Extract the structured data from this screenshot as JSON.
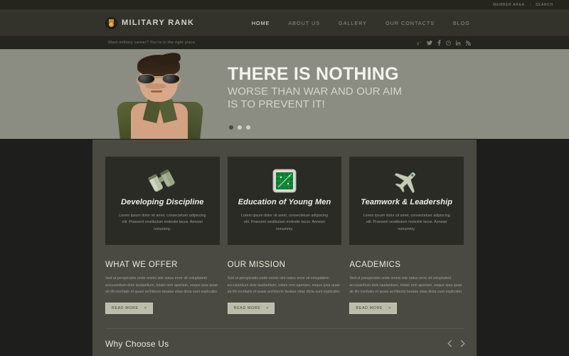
{
  "topbar": {
    "member_area": "MEMBER AREA",
    "separator": "|",
    "search": "SEARCH"
  },
  "header": {
    "logo_text": "MILITARY RANK",
    "logo_icon": "medal-icon",
    "nav": [
      {
        "label": "HOME",
        "active": true
      },
      {
        "label": "ABOUT US",
        "active": false
      },
      {
        "label": "GALLERY",
        "active": false
      },
      {
        "label": "OUR CONTACTS",
        "active": false
      },
      {
        "label": "BLOG",
        "active": false
      }
    ]
  },
  "tagline_bar": {
    "text": "Want military career? You're in the right place.",
    "social": [
      {
        "name": "google-plus-icon",
        "glyph": "g+"
      },
      {
        "name": "twitter-icon",
        "glyph": "t"
      },
      {
        "name": "facebook-icon",
        "glyph": "f"
      },
      {
        "name": "pinterest-icon",
        "glyph": "p"
      },
      {
        "name": "linkedin-icon",
        "glyph": "in"
      },
      {
        "name": "rss-icon",
        "glyph": "rss"
      }
    ]
  },
  "hero": {
    "title": "THERE IS NOTHING",
    "subtitle_line1": "WORSE THAN WAR AND OUR AIM",
    "subtitle_line2": "IS TO PREVENT IT!",
    "image_alt": "soldier-portrait",
    "slides_total": 3,
    "active_slide": 1,
    "bg_color": "#8b8d82"
  },
  "cards": [
    {
      "icon": "binoculars-icon",
      "title": "Developing Discipline",
      "text": "Lorem ipsum dolor sit amet, consectetuer adipiscing elit. Praesent vestibulum molestie lacus. Aenean nonummy."
    },
    {
      "icon": "radar-screen-icon",
      "title": "Education of Young Men",
      "text": "Lorem ipsum dolor sit amet, consectetuer adipiscing elit. Praesent vestibulum molestie lacus. Aenean nonummy."
    },
    {
      "icon": "fighter-jet-icon",
      "title": "Teamwork & Leadership",
      "text": "Lorem ipsum dolor sit amet, consectetuer adipiscing elit. Praesent vestibulum molestie lacus. Aenean nonummy."
    }
  ],
  "columns": [
    {
      "heading": "WHAT WE OFFER",
      "text": "Sed ut perspiciatis unde omnis iste natus error sit voluptatem accusantium dole laudantium, totam rem aperiam, eaque ipsa quae ab illo inertiato et quasi architecto beatae vitae dicta sunt explicabo.",
      "button": "READ MORE",
      "button_chevron": "»"
    },
    {
      "heading": "OUR MISSION",
      "text": "Sed ut perspiciatis unde omnis iste natus error sit voluptatem accusantium dole laudantium, totam rem aperiam, eaque ipsa quae ab illo invritatis et quasi architecto beatae vitae dicta sunt explicabo.",
      "button": "READ MORE",
      "button_chevron": "»"
    },
    {
      "heading": "ACADEMICS",
      "text": "Sed ut perspiciatis unde omnis iste natus error sit voluptatem accusantium dole laudantium, totam rem aperiam, eaque ipsa quae ab illo invritatis et quasi architecto beatae vitae dicta sunt explicabo.",
      "button": "READ MORE",
      "button_chevron": "»"
    }
  ],
  "bottom_section": {
    "heading": "Why Choose Us",
    "prev_label": "prev",
    "next_label": "next"
  },
  "colors": {
    "page_bg": "#1e1e1c",
    "header_bg": "#33332c",
    "hero_bg": "#8b8d82",
    "panel_bg": "#4a4a42",
    "card_bg": "#2b2b26",
    "button_bg": "#b9bda9",
    "accent_gold": "#c8922a"
  }
}
